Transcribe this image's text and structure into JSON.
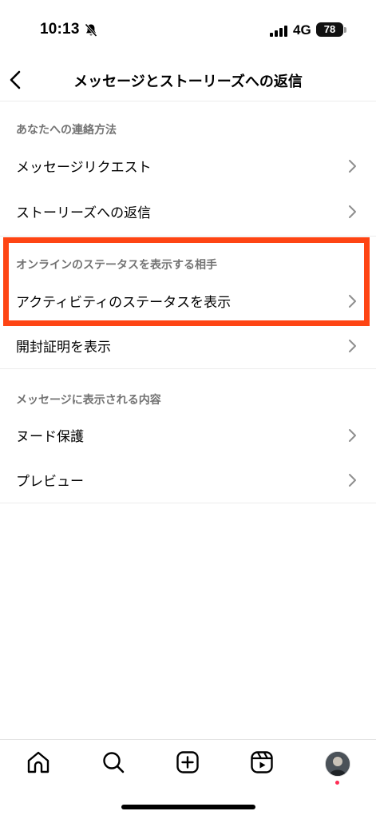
{
  "status_bar": {
    "time": "10:13",
    "network": "4G",
    "battery": "78"
  },
  "header": {
    "title": "メッセージとストーリーズへの返信"
  },
  "sections": [
    {
      "title": "あなたへの連絡方法",
      "items": [
        {
          "label": "メッセージリクエスト"
        },
        {
          "label": "ストーリーズへの返信"
        }
      ]
    },
    {
      "title": "オンラインのステータスを表示する相手",
      "items": [
        {
          "label": "アクティビティのステータスを表示"
        },
        {
          "label": "開封証明を表示"
        }
      ]
    },
    {
      "title": "メッセージに表示される内容",
      "items": [
        {
          "label": "ヌード保護"
        },
        {
          "label": "プレビュー"
        }
      ]
    }
  ],
  "highlight_color": "#fe4514",
  "tab_bar": {
    "items": [
      "home-icon",
      "search-icon",
      "create-icon",
      "reels-icon",
      "profile-avatar"
    ],
    "notification_dot_color": "#ff2d55"
  }
}
